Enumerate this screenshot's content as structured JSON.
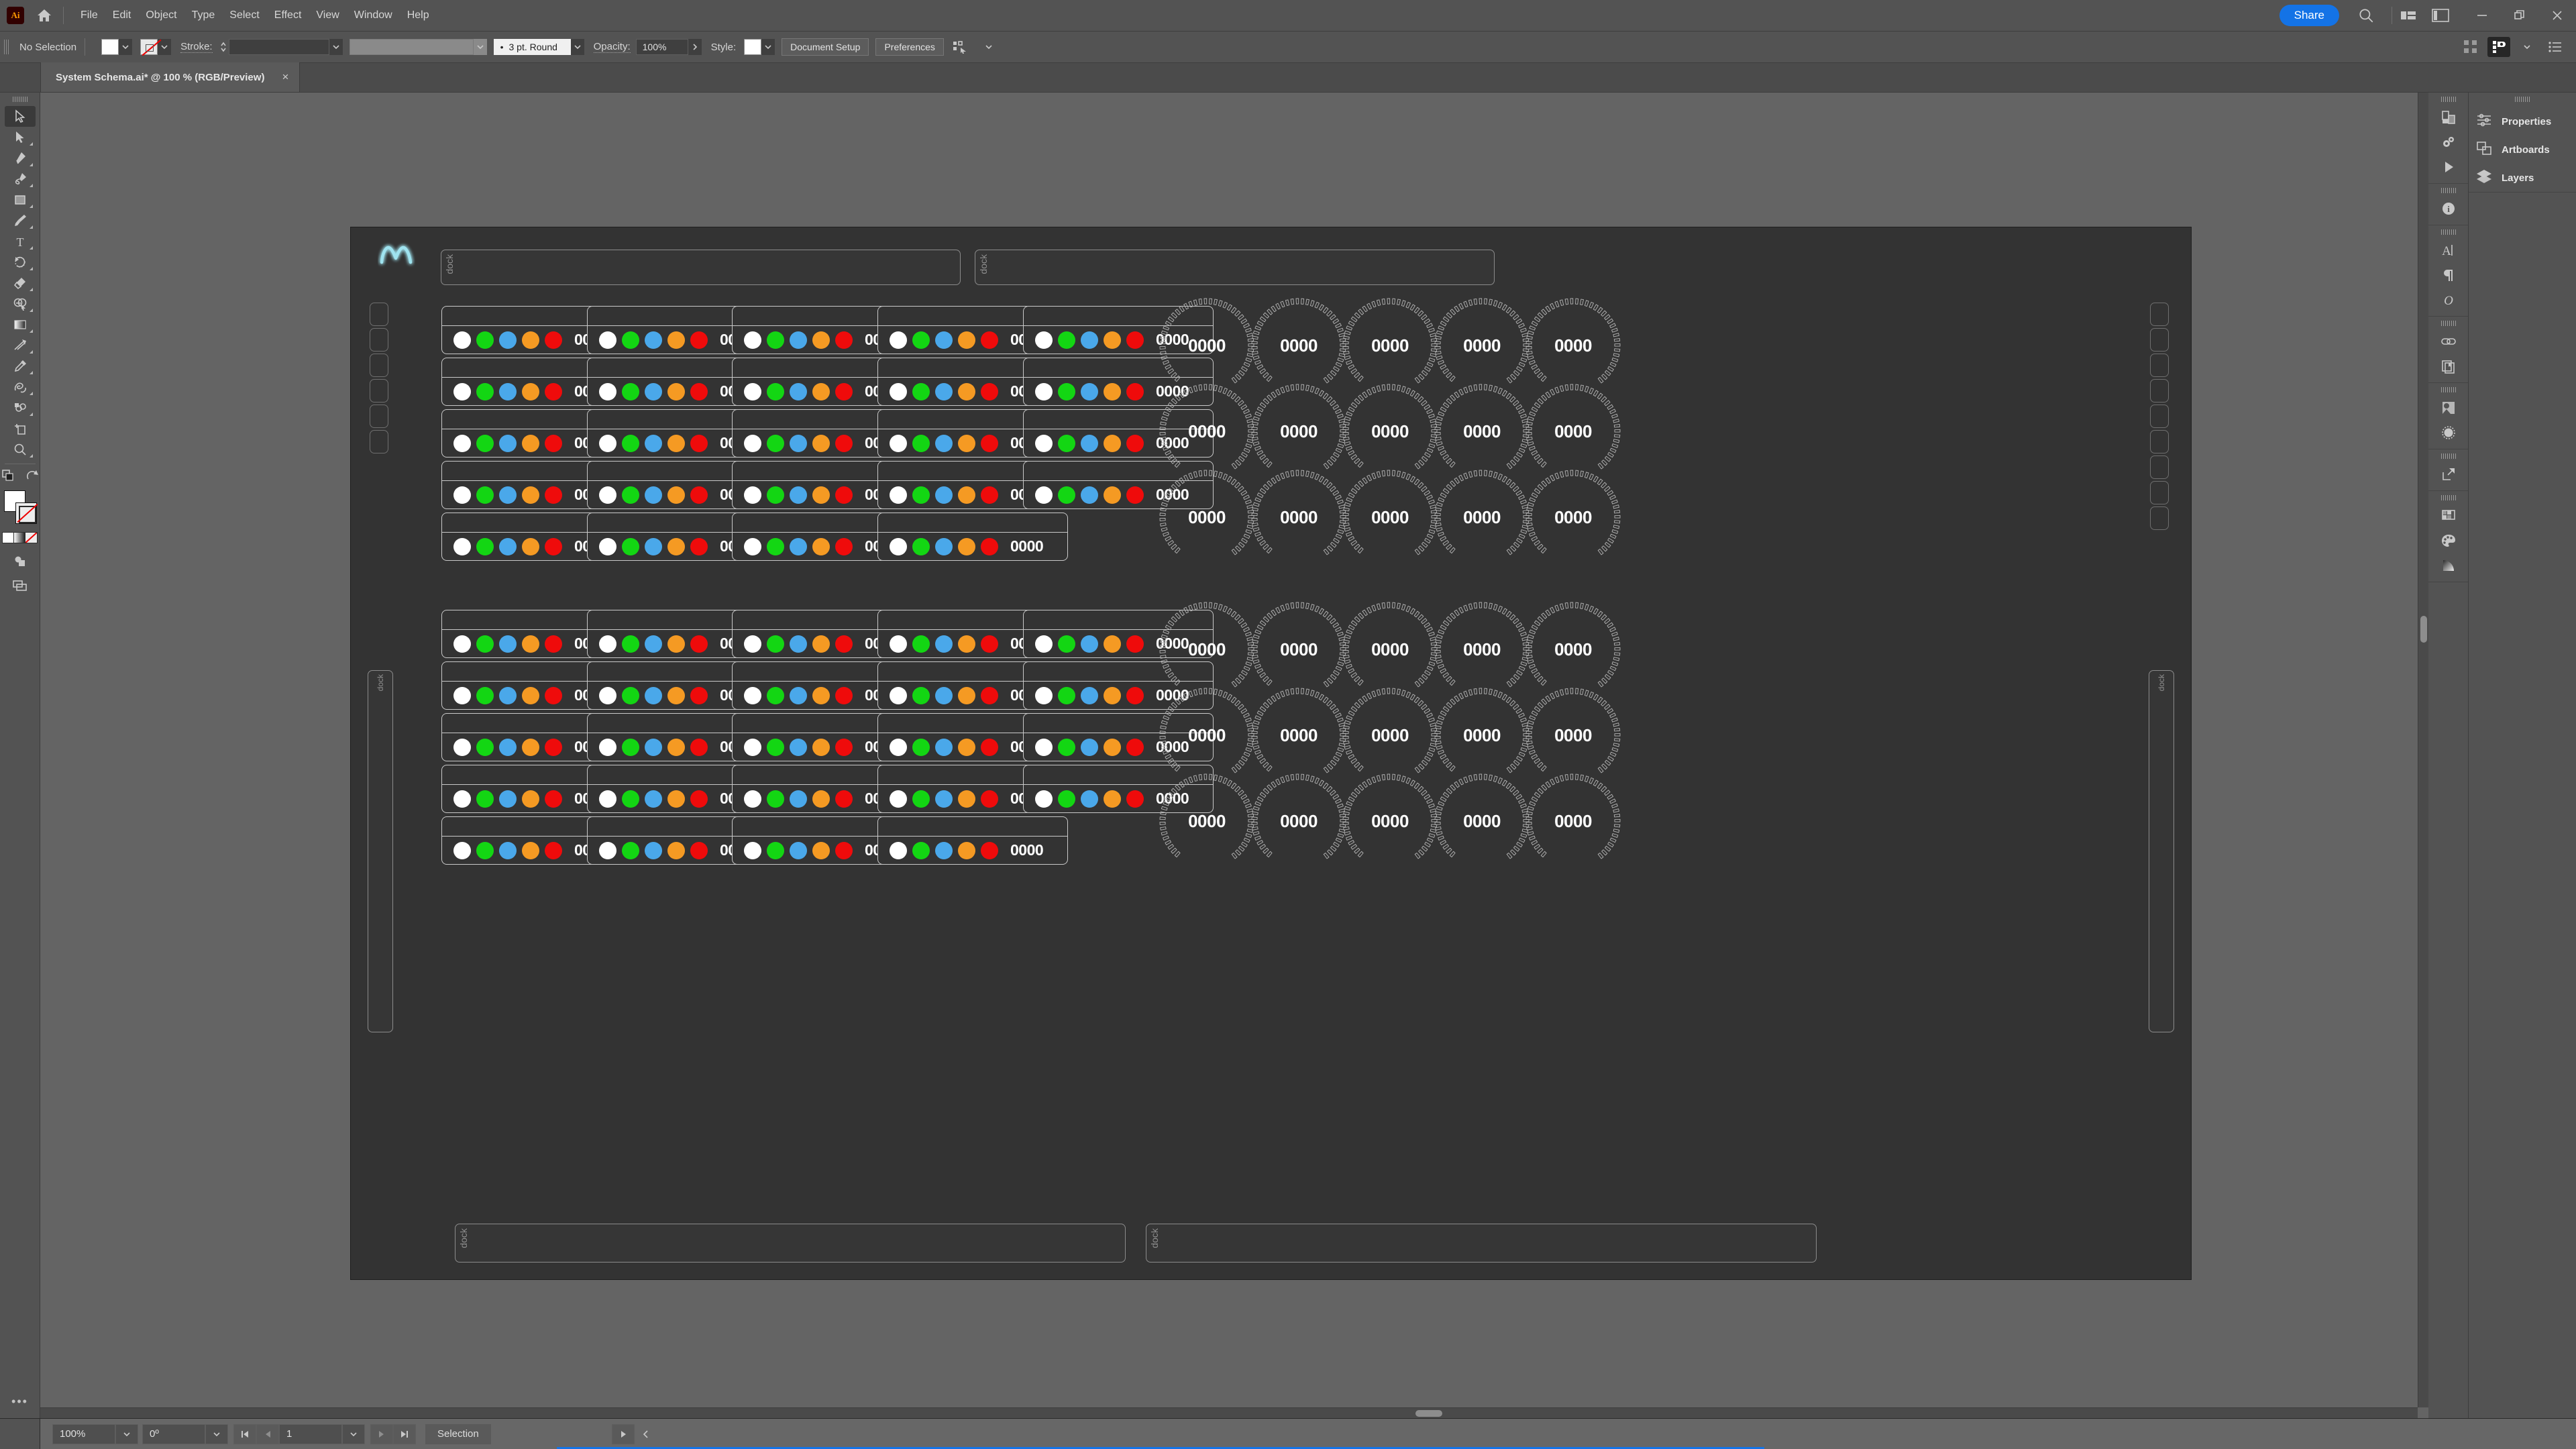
{
  "app": {
    "name": "Adobe Illustrator",
    "logo_text": "Ai",
    "home_icon": "home-icon"
  },
  "menubar": {
    "items": [
      "File",
      "Edit",
      "Object",
      "Type",
      "Select",
      "Effect",
      "View",
      "Window",
      "Help"
    ],
    "share_label": "Share",
    "search_icon": "search-icon",
    "arrange_icon": "arrange-documents-icon",
    "workspace_icon": "workspace-switcher-icon",
    "minimize_icon": "minimize-icon",
    "restore_icon": "restore-icon",
    "close_icon": "close-icon"
  },
  "controlbar": {
    "selection_status": "No Selection",
    "fill_swatch_color": "#ffffff",
    "stroke_swatch": "none",
    "stroke_label": "Stroke:",
    "stroke_weight": "",
    "stroke_profile": "",
    "brush_definition": "3 pt. Round",
    "opacity_label": "Opacity:",
    "opacity_value": "100%",
    "style_label": "Style:",
    "style_swatch_color": "#ffffff",
    "document_setup_label": "Document Setup",
    "preferences_label": "Preferences",
    "select_similar_icon": "select-similar-objects-icon",
    "align_icon": "align-grid-icon",
    "properties_icon": "properties-icon",
    "options_icon": "options-list-icon"
  },
  "tab": {
    "title": "System Schema.ai* @ 100 % (RGB/Preview)",
    "close_label": "×"
  },
  "toolbar": {
    "tools": [
      {
        "name": "selection-tool",
        "active": true,
        "has_flyout": false
      },
      {
        "name": "direct-selection-tool",
        "active": false,
        "has_flyout": true
      },
      {
        "name": "pen-tool",
        "active": false,
        "has_flyout": true
      },
      {
        "name": "curvature-tool",
        "active": false,
        "has_flyout": true
      },
      {
        "name": "rectangle-tool",
        "active": false,
        "has_flyout": true
      },
      {
        "name": "paintbrush-tool",
        "active": false,
        "has_flyout": true
      },
      {
        "name": "type-tool",
        "active": false,
        "has_flyout": true
      },
      {
        "name": "rotate-tool",
        "active": false,
        "has_flyout": true
      },
      {
        "name": "eraser-tool",
        "active": false,
        "has_flyout": true
      },
      {
        "name": "shape-builder-tool",
        "active": false,
        "has_flyout": true
      },
      {
        "name": "gradient-tool",
        "active": false,
        "has_flyout": true
      },
      {
        "name": "width-tool",
        "active": false,
        "has_flyout": true
      },
      {
        "name": "eyedropper-tool",
        "active": false,
        "has_flyout": true
      },
      {
        "name": "blend-tool",
        "active": false,
        "has_flyout": true
      },
      {
        "name": "symbol-sprayer-tool",
        "active": false,
        "has_flyout": true
      },
      {
        "name": "artboard-tool",
        "active": false,
        "has_flyout": false
      },
      {
        "name": "zoom-tool",
        "active": false,
        "has_flyout": true
      }
    ],
    "swap_fill_stroke_icon": "swap-fill-stroke-icon",
    "default-fill-stroke-icon": "default-fill-stroke-icon",
    "fill_color": "#ffffff",
    "stroke_color": "none",
    "draw_mode_icon": "draw-normal-icon",
    "screen_mode_icon": "screen-mode-icon",
    "more_tools_label": "•••"
  },
  "rightdock": {
    "panel_items": [
      {
        "label": "Properties",
        "icon": "properties-sliders-icon"
      },
      {
        "label": "Artboards",
        "icon": "artboards-icon"
      },
      {
        "label": "Layers",
        "icon": "layers-icon"
      }
    ],
    "rail_icons": [
      "libraries-icon",
      "gear-settings-icon",
      "play-actions-icon",
      "info-icon",
      "character-type-icon",
      "paragraph-icon",
      "opacity-mask-icon",
      "links-icon",
      "pages-icon",
      "image-trace-icon",
      "transparency-icon",
      "export-icon",
      "swatches-icon",
      "color-palette-icon",
      "gradient-panel-icon"
    ]
  },
  "canvas": {
    "artboard_bg": "#333333",
    "logo": "glowing-m-logo",
    "dock_label": "dock",
    "dock_zones": [
      {
        "name": "dock-top-left",
        "label": "dock"
      },
      {
        "name": "dock-top-right",
        "label": "dock"
      },
      {
        "name": "dock-left-rail",
        "label": "dock"
      },
      {
        "name": "dock-right-rail",
        "label": "dock"
      },
      {
        "name": "dock-bottom-left",
        "label": "dock"
      },
      {
        "name": "dock-bottom-right",
        "label": "dock"
      }
    ],
    "status_card": {
      "value": "0000",
      "dot_colors": [
        "#ffffff",
        "#13d613",
        "#4aa8ea",
        "#f59a23",
        "#ef0b0b"
      ],
      "dot_names": [
        "status-dot-white",
        "status-dot-green",
        "status-dot-blue",
        "status-dot-orange",
        "status-dot-red"
      ],
      "border_color": "#c9c9c9"
    },
    "gauge": {
      "value": "0000",
      "tick_color": "#b5b5b5",
      "tick_count": 44,
      "gap_degrees": 80
    },
    "card_groups": [
      {
        "name": "card-group-upper",
        "rows": [
          5,
          5,
          5,
          5,
          4
        ]
      },
      {
        "name": "card-group-lower",
        "rows": [
          5,
          5,
          5,
          5,
          4
        ]
      }
    ],
    "gauge_groups": [
      {
        "name": "gauge-group-upper",
        "rows": [
          5,
          5,
          5
        ]
      },
      {
        "name": "gauge-group-lower",
        "rows": [
          5,
          5,
          5
        ]
      }
    ]
  },
  "statusbar": {
    "zoom_level": "100%",
    "rotation": "0º",
    "artboard_number": "1",
    "active_tool": "Selection",
    "first_artboard_icon": "first-artboard-icon",
    "prev_artboard_icon": "prev-artboard-icon",
    "next_artboard_icon": "next-artboard-icon",
    "last_artboard_icon": "last-artboard-icon",
    "play_icon": "play-icon",
    "collapse_icon": "collapse-left-icon"
  }
}
